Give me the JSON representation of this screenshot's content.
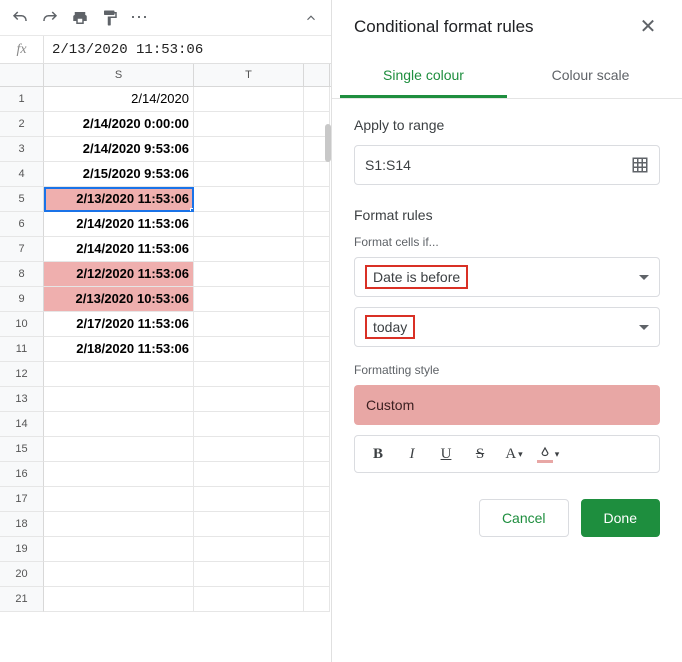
{
  "toolbar": {
    "icons": [
      "undo",
      "redo",
      "print",
      "paint-format",
      "more"
    ]
  },
  "formula_bar": {
    "fx": "fx",
    "value": "2/13/2020 11:53:06"
  },
  "columns": {
    "S": "S",
    "T": "T"
  },
  "rows": [
    {
      "n": "1",
      "s": "2/14/2020",
      "hl": false,
      "bold": false
    },
    {
      "n": "2",
      "s": "2/14/2020 0:00:00",
      "hl": false,
      "bold": true
    },
    {
      "n": "3",
      "s": "2/14/2020 9:53:06",
      "hl": false,
      "bold": true
    },
    {
      "n": "4",
      "s": "2/15/2020 9:53:06",
      "hl": false,
      "bold": true
    },
    {
      "n": "5",
      "s": "2/13/2020 11:53:06",
      "hl": true,
      "bold": true,
      "selected": true
    },
    {
      "n": "6",
      "s": "2/14/2020 11:53:06",
      "hl": false,
      "bold": true
    },
    {
      "n": "7",
      "s": "2/14/2020 11:53:06",
      "hl": false,
      "bold": true
    },
    {
      "n": "8",
      "s": "2/12/2020 11:53:06",
      "hl": true,
      "bold": true
    },
    {
      "n": "9",
      "s": "2/13/2020 10:53:06",
      "hl": true,
      "bold": true
    },
    {
      "n": "10",
      "s": "2/17/2020 11:53:06",
      "hl": false,
      "bold": true
    },
    {
      "n": "11",
      "s": "2/18/2020 11:53:06",
      "hl": false,
      "bold": true
    },
    {
      "n": "12",
      "s": "",
      "hl": false
    },
    {
      "n": "13",
      "s": "",
      "hl": false
    },
    {
      "n": "14",
      "s": "",
      "hl": false
    },
    {
      "n": "15",
      "s": "",
      "hl": false
    },
    {
      "n": "16",
      "s": "",
      "hl": false
    },
    {
      "n": "17",
      "s": "",
      "hl": false
    },
    {
      "n": "18",
      "s": "",
      "hl": false
    },
    {
      "n": "19",
      "s": "",
      "hl": false
    },
    {
      "n": "20",
      "s": "",
      "hl": false
    },
    {
      "n": "21",
      "s": "",
      "hl": false
    }
  ],
  "sidebar": {
    "title": "Conditional format rules",
    "tabs": {
      "single": "Single colour",
      "scale": "Colour scale"
    },
    "apply_label": "Apply to range",
    "range": "S1:S14",
    "rules_label": "Format rules",
    "cells_if_label": "Format cells if...",
    "condition": "Date is before",
    "condition_value": "today",
    "style_label": "Formatting style",
    "style_name": "Custom",
    "fmt": {
      "bold": "B",
      "italic": "I",
      "underline": "U",
      "strike": "S",
      "textcolor": "A"
    },
    "cancel": "Cancel",
    "done": "Done"
  }
}
